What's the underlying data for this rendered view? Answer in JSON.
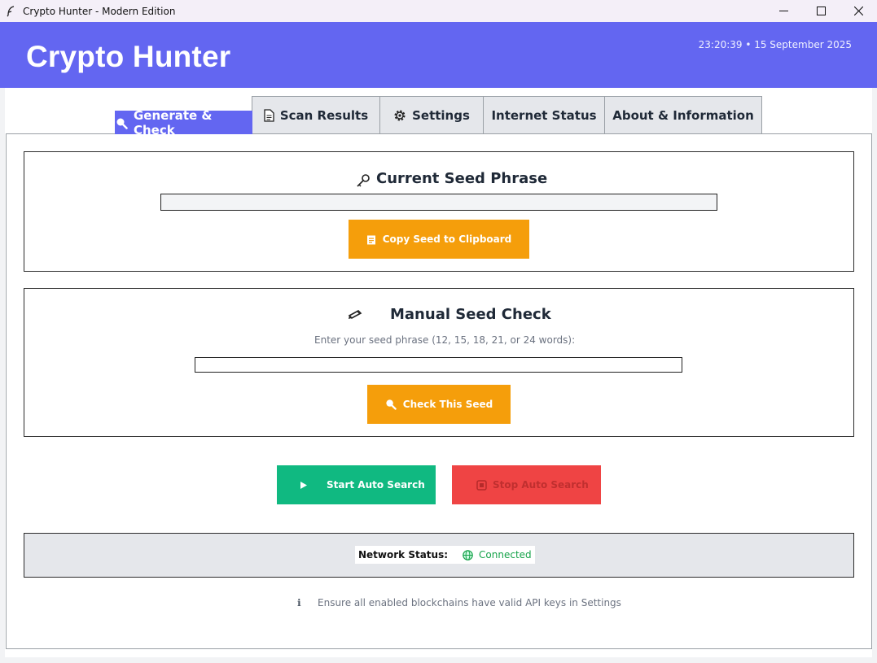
{
  "window": {
    "title": "Crypto Hunter - Modern Edition",
    "icons": {
      "app": "feather-icon",
      "minimize": "minimize-icon",
      "maximize": "maximize-icon",
      "close": "close-icon"
    }
  },
  "header": {
    "title": "Crypto Hunter",
    "clock": "23:20:39 • 15 September 2025"
  },
  "tabs": [
    {
      "label": "Generate & Check",
      "icon": "magnifier-icon",
      "active": true
    },
    {
      "label": "Scan Results",
      "icon": "document-icon",
      "active": false
    },
    {
      "label": "Settings",
      "icon": "gear-icon",
      "active": false
    },
    {
      "label": "Internet Status",
      "icon": "",
      "active": false
    },
    {
      "label": "About & Information",
      "icon": "",
      "active": false
    }
  ],
  "current_seed": {
    "title": "Current Seed Phrase",
    "icon": "key-icon",
    "value": "",
    "copy_button": "Copy Seed to Clipboard",
    "copy_icon": "clipboard-icon"
  },
  "manual_check": {
    "title": "Manual Seed Check",
    "icon": "pencil-icon",
    "instruction": "Enter your seed phrase (12, 15, 18, 21, or 24 words):",
    "value": "",
    "check_button": "Check This Seed",
    "check_icon": "magnifier-icon"
  },
  "auto_search": {
    "start_label": "Start Auto Search",
    "start_icon": "play-icon",
    "stop_label": "Stop Auto Search",
    "stop_icon": "stop-icon",
    "stop_enabled": false
  },
  "network": {
    "label": "Network Status:",
    "value": "Connected",
    "icon": "globe-icon"
  },
  "footer_note": {
    "icon": "info-icon",
    "text": "Ensure all enabled blockchains have valid API keys in Settings"
  },
  "colors": {
    "accent": "#6366f1",
    "orange": "#f59e0b",
    "green": "#10b981",
    "red": "#ef4444",
    "connected": "#16a34a"
  }
}
